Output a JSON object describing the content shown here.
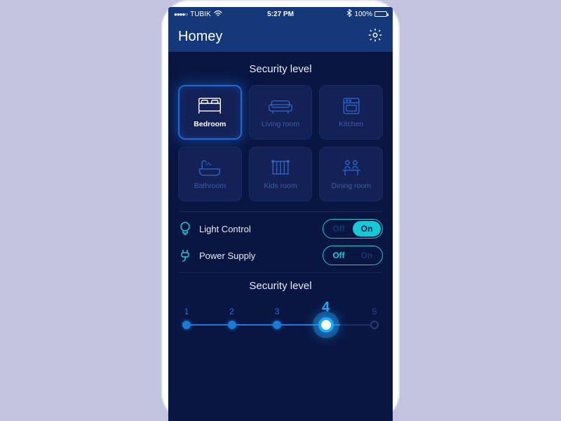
{
  "status": {
    "carrier": "TUBIK",
    "time": "5:27 PM",
    "battery": "100%"
  },
  "header": {
    "title": "Homey"
  },
  "section_title": "Security level",
  "rooms": [
    {
      "label": "Bedroom",
      "active": true
    },
    {
      "label": "Living room",
      "active": false
    },
    {
      "label": "Kitchen",
      "active": false
    },
    {
      "label": "Bathroom",
      "active": false
    },
    {
      "label": "Kids room",
      "active": false
    },
    {
      "label": "Dining room",
      "active": false
    }
  ],
  "controls": {
    "light": {
      "label": "Light Control",
      "off": "Off",
      "on": "On",
      "state": "On"
    },
    "power": {
      "label": "Power Supply",
      "off": "Off",
      "on": "On",
      "state": "Off"
    }
  },
  "slider": {
    "title": "Security level",
    "steps": [
      "1",
      "2",
      "3",
      "4",
      "5"
    ],
    "active_index": 3
  }
}
